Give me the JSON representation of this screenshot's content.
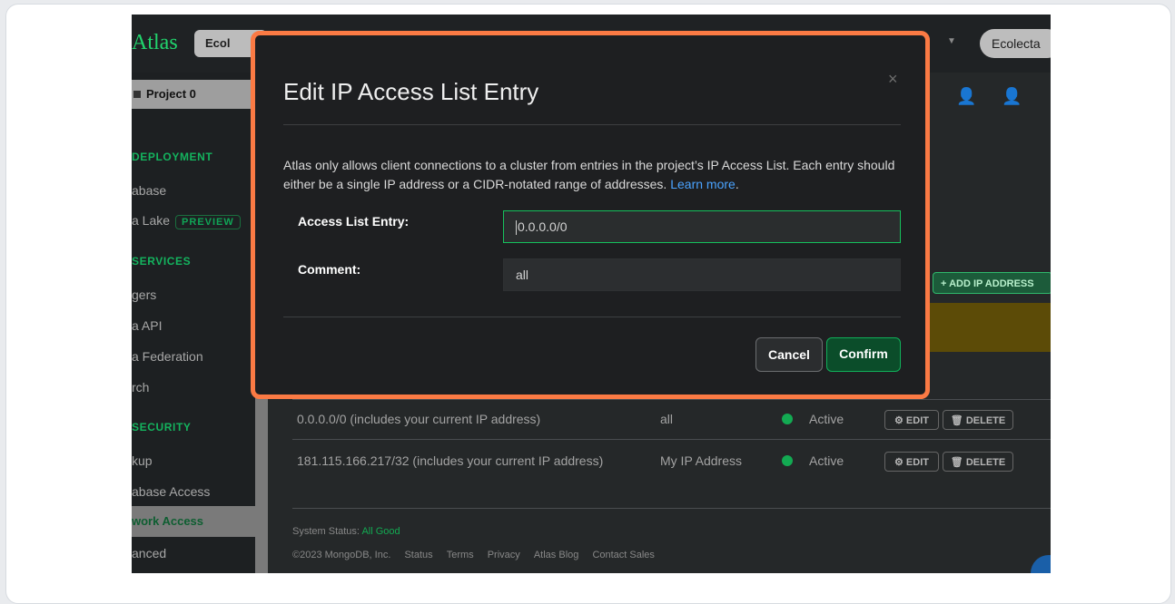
{
  "app": {
    "logo": "Atlas",
    "org_label": "Ecol",
    "user_label": "Ecolecta",
    "project_label": "Project 0"
  },
  "sidebar": {
    "deployment_header": "DEPLOYMENT",
    "database_item": "abase",
    "data_lake_item": "a Lake",
    "preview_badge": "PREVIEW",
    "services_header": "SERVICES",
    "triggers_item": "gers",
    "data_api_item": "a API",
    "data_federation_item": "a Federation",
    "search_item": "rch",
    "security_header": "SECURITY",
    "backup_item": "kup",
    "database_access_item": "abase Access",
    "network_access_item": "work Access",
    "advanced_item": "anced"
  },
  "main": {
    "add_ip_button": "+ ADD IP ADDRESS",
    "rows": [
      {
        "address": "0.0.0.0/0  (includes your current IP address)",
        "comment": "all",
        "status": "Active",
        "edit": "EDIT",
        "delete": "DELETE"
      },
      {
        "address": "181.115.166.217/32  (includes your current IP address)",
        "comment": "My IP Address",
        "status": "Active",
        "edit": "EDIT",
        "delete": "DELETE"
      }
    ],
    "footer": {
      "system_status_label": "System Status:",
      "system_status_value": "All Good",
      "copyright": "©2023 MongoDB, Inc.",
      "links": [
        "Status",
        "Terms",
        "Privacy",
        "Atlas Blog",
        "Contact Sales"
      ]
    }
  },
  "modal": {
    "title": "Edit IP Access List Entry",
    "close": "×",
    "description": "Atlas only allows client connections to a cluster from entries in the project’s IP Access List. Each entry should either be a single IP address or a CIDR-notated range of addresses.",
    "learn_more": "Learn more",
    "access_list_label": "Access List Entry:",
    "access_list_value": "0.0.0.0/0",
    "comment_label": "Comment:",
    "comment_value": "all",
    "cancel_label": "Cancel",
    "confirm_label": "Confirm"
  },
  "colors": {
    "highlight_border": "#fb7a44",
    "accent_green": "#13aa52",
    "link_blue": "#4aa3ff"
  }
}
